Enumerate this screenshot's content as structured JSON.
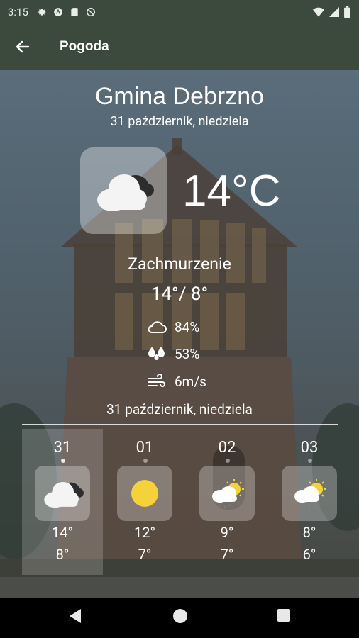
{
  "status_bar": {
    "time": "3:15",
    "icons_left": [
      "settings-icon",
      "app-icon",
      "sd-card-icon",
      "blocked-icon"
    ],
    "icons_right": [
      "wifi-icon",
      "signal-icon",
      "battery-icon"
    ]
  },
  "app_bar": {
    "title": "Pogoda",
    "back_icon": "arrow-back-icon"
  },
  "location": {
    "city": "Gmina Debrzno",
    "date": "31 październik, niedziela"
  },
  "current": {
    "icon": "cloudy-icon",
    "temperature": "14°C",
    "condition": "Zachmurzenie",
    "minmax": "14°/ 8°",
    "cloudiness": "84%",
    "humidity": "53%",
    "wind": "6m/s"
  },
  "selected_date": "31 październik, niedziela",
  "forecast": [
    {
      "day": "31",
      "icon": "cloudy-icon",
      "high": "14°",
      "low": "8°",
      "selected": true
    },
    {
      "day": "01",
      "icon": "sun-icon",
      "high": "12°",
      "low": "7°",
      "selected": false
    },
    {
      "day": "02",
      "icon": "sun-cloud-rain-icon",
      "high": "9°",
      "low": "7°",
      "selected": false
    },
    {
      "day": "03",
      "icon": "sun-cloud-rain-icon",
      "high": "8°",
      "low": "6°",
      "selected": false
    }
  ],
  "colors": {
    "app_bar": "#3b4a3d",
    "sun": "#f5d13a",
    "text": "#ffffff"
  },
  "nav_bar": {
    "icons": [
      "back-triangle-icon",
      "home-circle-icon",
      "recents-square-icon"
    ]
  }
}
